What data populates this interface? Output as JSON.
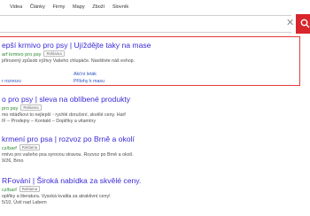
{
  "nav": [
    "Videa",
    "Články",
    "Firmy",
    "Mapy",
    "Zboží",
    "Slovník"
  ],
  "search": {
    "clear_icon": "close-icon",
    "search_icon": "search-icon"
  },
  "ad": {
    "title": "epší krmivo pro psy | Ujíždějte taky na mase",
    "url": "arf krmivo pro psy",
    "badge": "Reklama",
    "desc": "přirozený způsob výživy Vašeho chlupáče. Navštivte náš eshop.",
    "sublinks": [
      "Akční leták",
      "r rozvozu",
      "Příloha k masu"
    ],
    "sublink_left_2": "r rozvozu",
    "sublink_right_1": "Akční leták",
    "sublink_right_2": "Přílohy k masu"
  },
  "results": [
    {
      "title": "o pro psy | sleva na oblíbené produkty",
      "url": "pro psy",
      "badge": "Reklama",
      "desc1": "mo mláďkovi to nejlepší - rychlé doručení, skvělé ceny. Harf",
      "desc2": "IF – Prodejny – Kontakt – Doplňky a vitamíny"
    },
    {
      "title": "krmení pro psa | rozvoz po Brně a okolí",
      "url": "cz/barf",
      "badge": "Reklama",
      "desc1": "rmivo pro vašeho psa syrovou stravou. Rozvoz po Brně a okolí.",
      "desc2": "9/26, Brno"
    },
    {
      "title": "RFování | Široká nabídka za skvělé ceny.",
      "url": "cz/barf",
      "badge": "Reklama",
      "desc1": "oplňky a literatura. Vysoká kvalita za atraktivní ceny!",
      "desc2": "5/10, Ústí nad Labem"
    }
  ]
}
